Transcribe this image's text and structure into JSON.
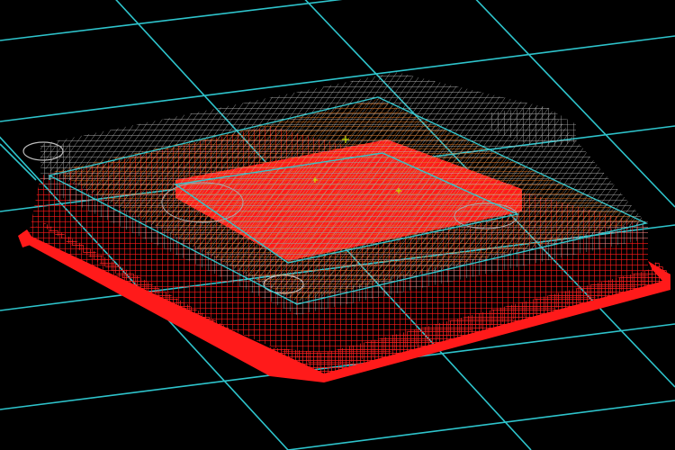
{
  "viewport": {
    "background": "#000000",
    "grid_color": "#2ec4cc",
    "colors": {
      "bottom_mesh": "#ff1a1a",
      "top_mesh": "#c8c8c8",
      "middle_mesh": "#e0741c",
      "outline": "#34c3c8",
      "markers": "#c8e000"
    }
  }
}
